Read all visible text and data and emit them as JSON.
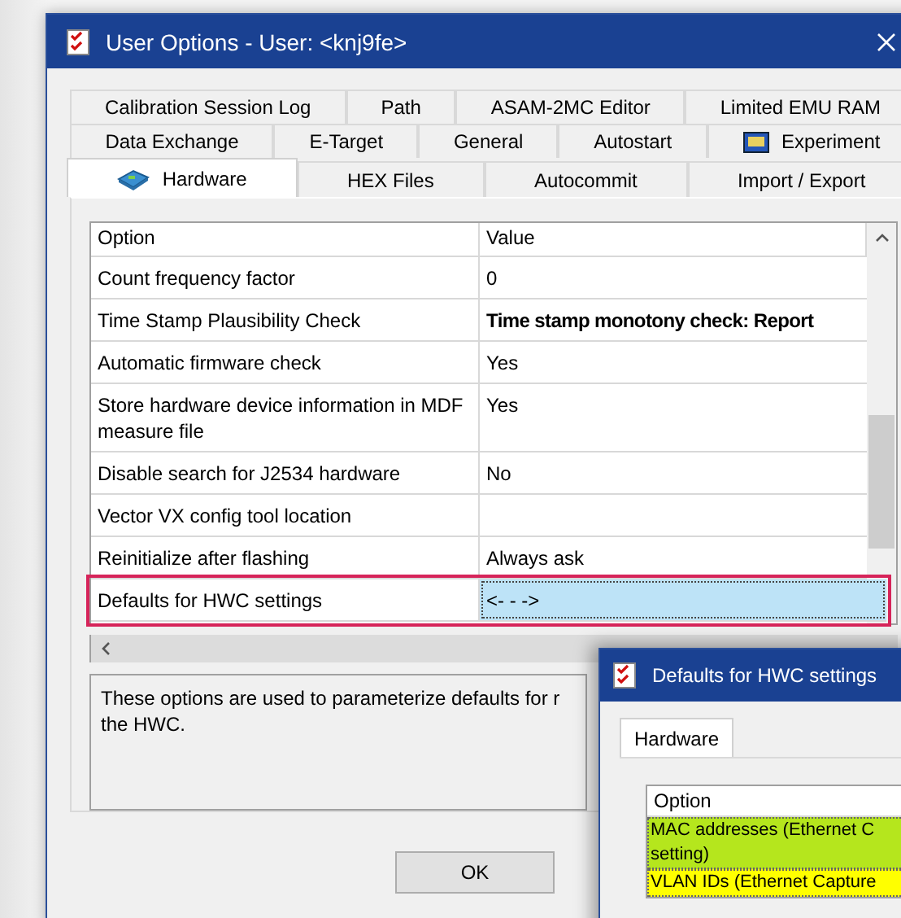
{
  "window": {
    "title": "User Options - User: <knj9fe>"
  },
  "tab_rows": [
    [
      {
        "label": "Calibration Session Log",
        "selected": false
      },
      {
        "label": "Path",
        "selected": false
      },
      {
        "label": "ASAM-2MC Editor",
        "selected": false
      },
      {
        "label": "Limited EMU RAM",
        "selected": false
      }
    ],
    [
      {
        "label": "Data Exchange",
        "selected": false
      },
      {
        "label": "E-Target",
        "selected": false
      },
      {
        "label": "General",
        "selected": false
      },
      {
        "label": "Autostart",
        "selected": false
      },
      {
        "label": "Experiment",
        "selected": false
      }
    ],
    [
      {
        "label": "Hardware",
        "selected": true
      },
      {
        "label": "HEX Files",
        "selected": false
      },
      {
        "label": "Autocommit",
        "selected": false
      },
      {
        "label": "Import / Export",
        "selected": false
      }
    ]
  ],
  "grid": {
    "columns": [
      "Option",
      "Value"
    ],
    "rows": [
      {
        "option": "Count frequency factor",
        "value": "0",
        "selected": false,
        "bold": false
      },
      {
        "option": "Time Stamp Plausibility Check",
        "value": "Time stamp monotony check: Report",
        "selected": false,
        "bold": true
      },
      {
        "option": "Automatic firmware check",
        "value": "Yes",
        "selected": false,
        "bold": false
      },
      {
        "option": "Store  hardware device information in MDF measure file",
        "value": "Yes",
        "selected": false,
        "bold": false
      },
      {
        "option": "Disable search for J2534 hardware",
        "value": "No",
        "selected": false,
        "bold": false
      },
      {
        "option": "Vector VX config tool location",
        "selected": false
      },
      {
        "option": "Reinitialize after flashing",
        "value": "Always ask",
        "selected": false,
        "bold": false
      },
      {
        "option": "Defaults for HWC settings",
        "value": "<- - ->",
        "selected": true,
        "bold": false
      }
    ]
  },
  "description": "These options are used to parameterize defaults for r the HWC.",
  "buttons": [
    "OK"
  ],
  "dialog": {
    "title": "Defaults for HWC settings",
    "tabs": [
      {
        "label": "Hardware",
        "selected": true
      }
    ],
    "column": "Option",
    "rows": [
      {
        "option": "MAC addresses (Ethernet C\nsetting)",
        "color": "#b5e61d"
      },
      {
        "option": "VLAN IDs (Ethernet Capture",
        "color": "#ffff00"
      }
    ]
  }
}
